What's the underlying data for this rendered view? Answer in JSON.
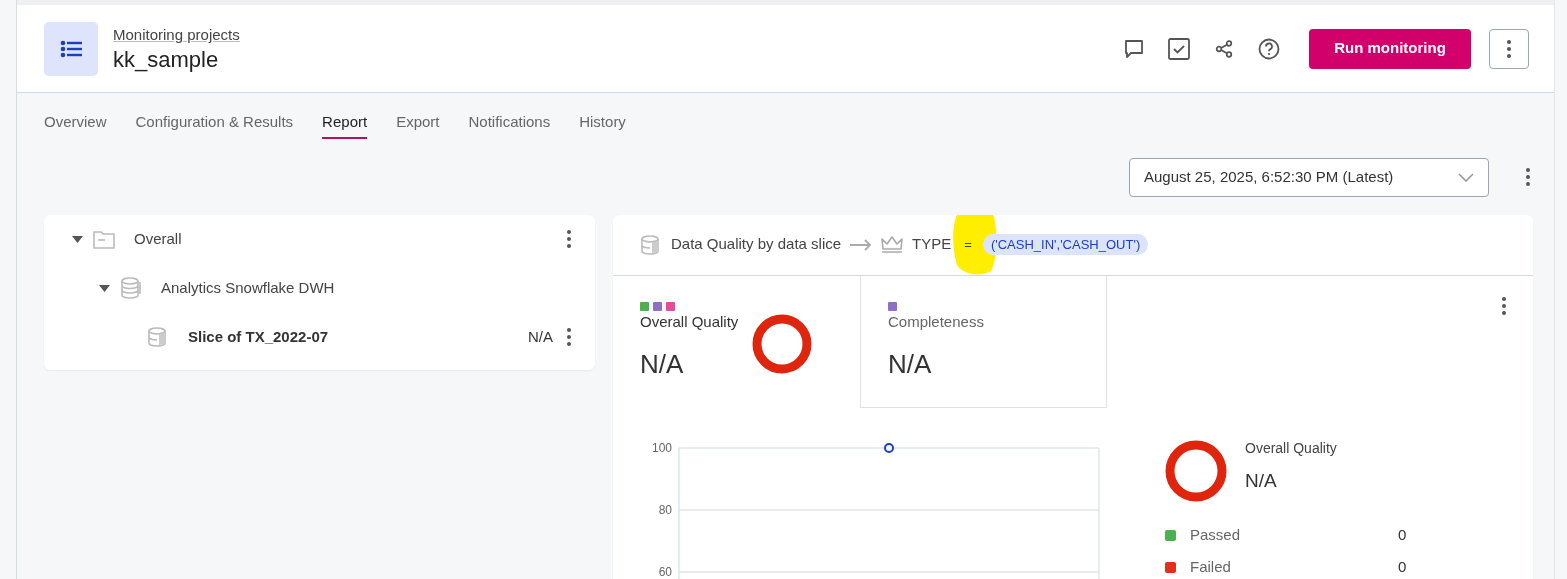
{
  "header": {
    "breadcrumb": "Monitoring projects",
    "title": "kk_sample",
    "primary_button": "Run monitoring"
  },
  "tabs": [
    {
      "label": "Overview",
      "selected": false
    },
    {
      "label": "Configuration & Results",
      "selected": false
    },
    {
      "label": "Report",
      "selected": true
    },
    {
      "label": "Export",
      "selected": false
    },
    {
      "label": "Notifications",
      "selected": false
    },
    {
      "label": "History",
      "selected": false
    }
  ],
  "run_selector": {
    "value": "August 25, 2025, 6:52:30 PM (Latest)"
  },
  "tree": [
    {
      "label": "Overall",
      "kind": "folder",
      "expanded": true,
      "selected": false,
      "has_menu": true,
      "children": [
        {
          "label": "Analytics Snowflake DWH",
          "kind": "database",
          "expanded": true,
          "selected": false,
          "has_menu": false,
          "children": [
            {
              "label": "Slice of TX_2022-07",
              "kind": "slice",
              "selected": true,
              "has_menu": true,
              "score": "N/A"
            }
          ]
        }
      ]
    }
  ],
  "slice_path": {
    "source": "Data Quality by data slice",
    "column": "TYPE",
    "operator": "=",
    "value": "('CASH_IN','CASH_OUT')"
  },
  "metrics": [
    {
      "title": "Overall Quality",
      "value": "N/A",
      "selected": true,
      "dots": [
        {
          "color": "#4caf50"
        },
        {
          "color": "#8e6fc8"
        },
        {
          "color": "#e84a9a"
        }
      ]
    },
    {
      "title": "Completeness",
      "value": "N/A",
      "selected": false,
      "dots": [
        {
          "color": "#8e6fc8"
        }
      ]
    }
  ],
  "trend": {
    "chart_data": {
      "type": "scatter",
      "yticks": [
        60,
        80,
        100
      ],
      "ylim": [
        55,
        100
      ],
      "values": [
        100
      ]
    }
  },
  "summary": {
    "title": "Overall Quality",
    "value": "N/A",
    "legend": [
      {
        "label": "Passed",
        "count": "0",
        "color": "#4caf50"
      },
      {
        "label": "Failed",
        "count": "0",
        "color": "#e0301e"
      }
    ]
  }
}
